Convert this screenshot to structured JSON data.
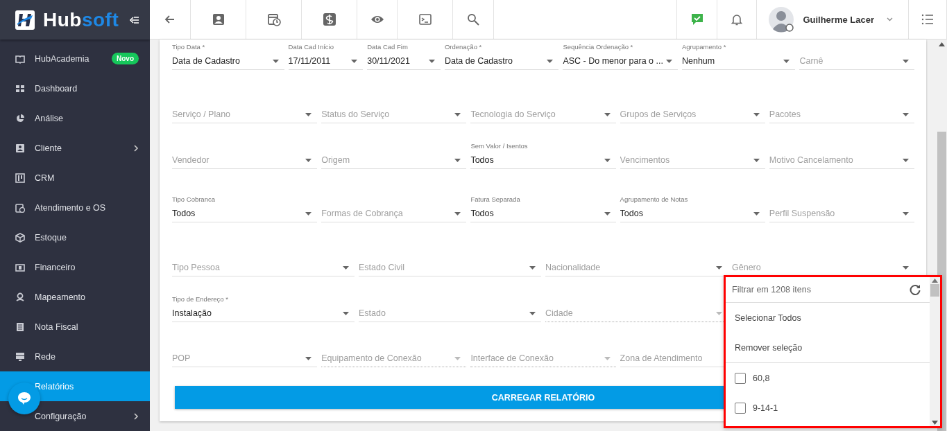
{
  "sidebar": {
    "brand": [
      "Hub",
      "soft"
    ],
    "items": [
      {
        "label": "HubAcademia",
        "badge": "Novo",
        "expandable": false,
        "selected": false
      },
      {
        "label": "Dashboard",
        "expandable": false,
        "selected": false
      },
      {
        "label": "Análise",
        "expandable": false,
        "selected": false
      },
      {
        "label": "Cliente",
        "expandable": true,
        "selected": false
      },
      {
        "label": "CRM",
        "expandable": false,
        "selected": false
      },
      {
        "label": "Atendimento e OS",
        "expandable": false,
        "selected": false
      },
      {
        "label": "Estoque",
        "expandable": false,
        "selected": false
      },
      {
        "label": "Financeiro",
        "expandable": false,
        "selected": false
      },
      {
        "label": "Mapeamento",
        "expandable": false,
        "selected": false
      },
      {
        "label": "Nota Fiscal",
        "expandable": false,
        "selected": false
      },
      {
        "label": "Rede",
        "expandable": false,
        "selected": false
      },
      {
        "label": "Relatórios",
        "expandable": false,
        "selected": true
      },
      {
        "label": "Configuração",
        "expandable": true,
        "selected": false
      }
    ]
  },
  "topbar": {
    "user_name": "Guilherme Lacer"
  },
  "form": {
    "rows": [
      {
        "fields": [
          {
            "label": "Tipo Data *",
            "value": "Data de Cadastro",
            "disabled": false
          },
          {
            "label": "Data Cad Início",
            "value": "17/11/2011",
            "disabled": false
          },
          {
            "label": "Data Cad Fim",
            "value": "30/11/2021",
            "disabled": false
          },
          {
            "label": "Ordenação *",
            "value": "Data de Cadastro",
            "disabled": false
          },
          {
            "label": "Sequência Ordenação *",
            "value": "ASC - Do menor para o ...",
            "disabled": false
          },
          {
            "label": "Agrupamento *",
            "value": "Nenhum",
            "disabled": false
          },
          {
            "placeholder": "Carnê",
            "disabled": false
          }
        ]
      },
      {
        "fields": [
          {
            "placeholder": "Serviço / Plano",
            "disabled": false
          },
          {
            "placeholder": "Status do Serviço",
            "disabled": false
          },
          {
            "placeholder": "Tecnologia do Serviço",
            "disabled": false
          },
          {
            "placeholder": "Grupos de Serviços",
            "disabled": false
          },
          {
            "placeholder": "Pacotes",
            "disabled": false
          }
        ]
      },
      {
        "fields": [
          {
            "placeholder": "Vendedor",
            "disabled": false
          },
          {
            "placeholder": "Origem",
            "disabled": false
          },
          {
            "label": "Sem Valor / Isentos",
            "value": "Todos",
            "disabled": false
          },
          {
            "placeholder": "Vencimentos",
            "disabled": false
          },
          {
            "placeholder": "Motivo Cancelamento",
            "disabled": false
          }
        ]
      },
      {
        "fields": [
          {
            "label": "Tipo Cobranca",
            "value": "Todos",
            "disabled": false
          },
          {
            "placeholder": "Formas de Cobrança",
            "disabled": false
          },
          {
            "label": "Fatura Separada",
            "value": "Todos",
            "disabled": false
          },
          {
            "label": "Agrupamento de Notas",
            "value": "Todos",
            "disabled": false
          },
          {
            "placeholder": "Perfil Suspensão",
            "disabled": false
          }
        ]
      },
      {
        "fields": [
          {
            "placeholder": "Tipo Pessoa",
            "disabled": false
          },
          {
            "placeholder": "Estado Civil",
            "disabled": false
          },
          {
            "placeholder": "Nacionalidade",
            "disabled": false
          },
          {
            "placeholder": "Gênero",
            "disabled": false
          }
        ]
      },
      {
        "fields": [
          {
            "label": "Tipo de Endereço *",
            "value": "Instalação",
            "disabled": false
          },
          {
            "placeholder": "Estado",
            "disabled": false
          },
          {
            "placeholder": "Cidade",
            "disabled": true
          }
        ]
      },
      {
        "fields": [
          {
            "placeholder": "POP",
            "disabled": false
          },
          {
            "placeholder": "Equipamento de Conexão",
            "disabled": true
          },
          {
            "placeholder": "Interface de Conexão",
            "disabled": true
          },
          {
            "placeholder": "Zona de Atendimento",
            "disabled": false
          }
        ]
      }
    ],
    "submit": "CARREGAR RELATÓRIO"
  },
  "dropdown": {
    "filter_placeholder": "Filtrar em 1208 itens",
    "actions": [
      "Selecionar Todos",
      "Remover seleção"
    ],
    "options": [
      {
        "label": "60,8",
        "checked": false
      },
      {
        "label": "9-14-1",
        "checked": false
      }
    ]
  }
}
